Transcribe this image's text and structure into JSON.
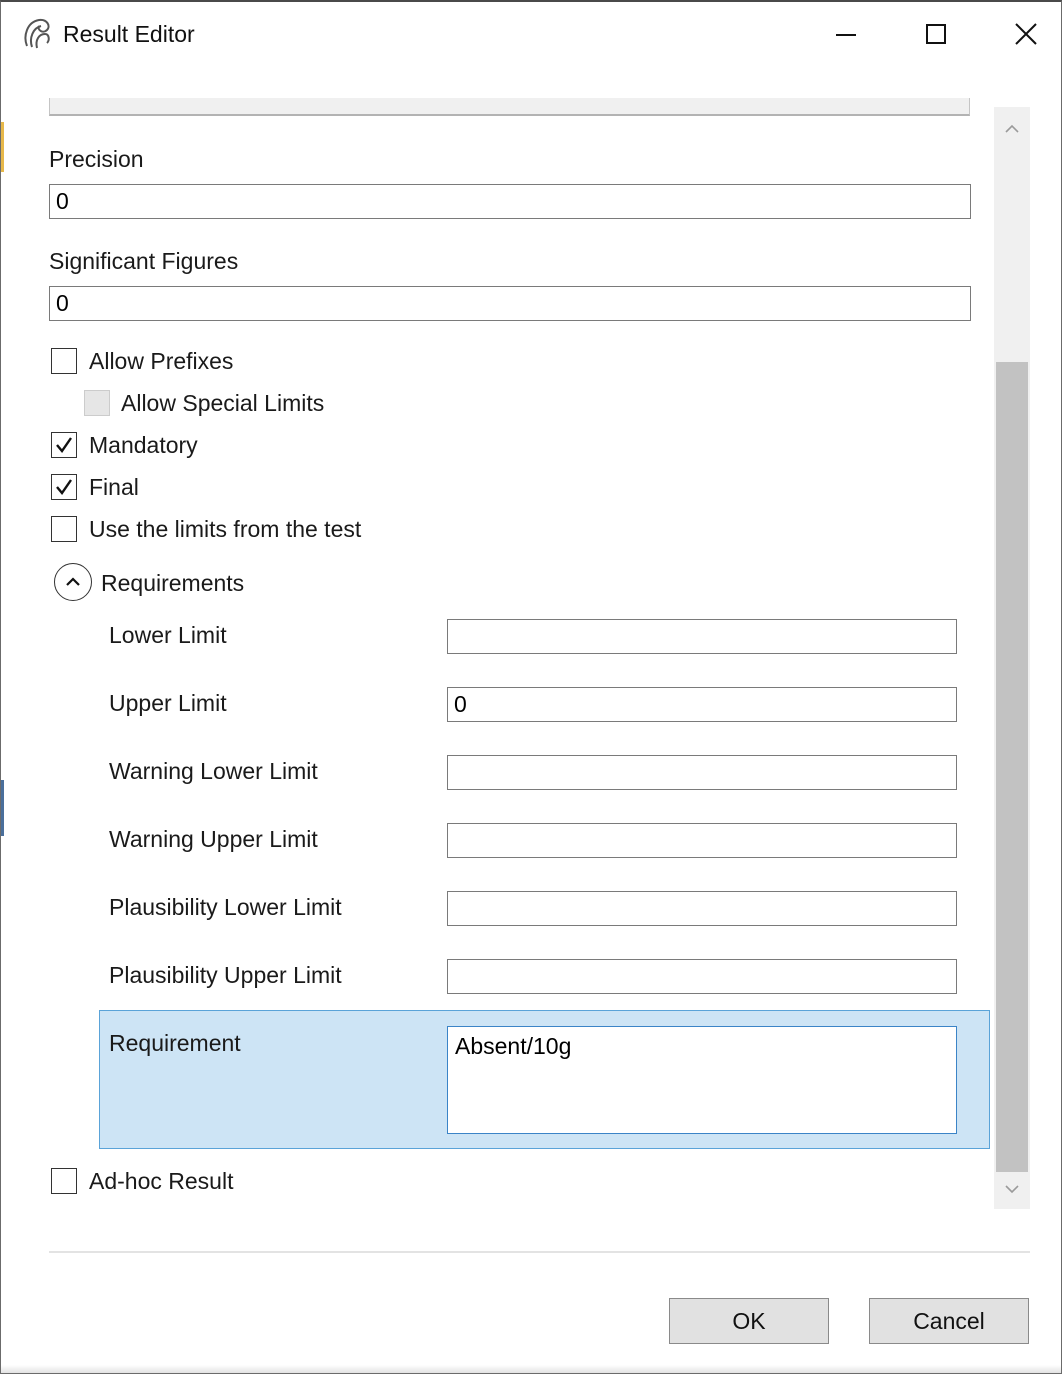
{
  "window": {
    "title": "Result Editor",
    "controls": {
      "minimize_icon": "minimize-icon",
      "maximize_icon": "maximize-icon",
      "close_icon": "close-icon"
    }
  },
  "form": {
    "precision": {
      "label": "Precision",
      "value": "0"
    },
    "significant_figures": {
      "label": "Significant Figures",
      "value": "0"
    },
    "checkboxes": {
      "allow_prefixes": {
        "label": "Allow Prefixes",
        "checked": false
      },
      "allow_special_limits": {
        "label": "Allow Special Limits",
        "checked": false,
        "enabled": false
      },
      "mandatory": {
        "label": "Mandatory",
        "checked": true
      },
      "final": {
        "label": "Final",
        "checked": true
      },
      "use_test_limits": {
        "label": "Use the limits from the test",
        "checked": false
      },
      "ad_hoc_result": {
        "label": "Ad-hoc Result",
        "checked": false
      }
    },
    "requirements": {
      "header": "Requirements",
      "expanded": true,
      "lower_limit": {
        "label": "Lower Limit",
        "value": ""
      },
      "upper_limit": {
        "label": "Upper Limit",
        "value": "0"
      },
      "warning_lower_limit": {
        "label": "Warning Lower Limit",
        "value": ""
      },
      "warning_upper_limit": {
        "label": "Warning Upper Limit",
        "value": ""
      },
      "plausibility_lower_limit": {
        "label": "Plausibility Lower Limit",
        "value": ""
      },
      "plausibility_upper_limit": {
        "label": "Plausibility Upper Limit",
        "value": ""
      },
      "requirement": {
        "label": "Requirement",
        "value": "Absent/10g"
      }
    }
  },
  "buttons": {
    "ok": "OK",
    "cancel": "Cancel"
  },
  "colors": {
    "selection_fill": "#cde4f5",
    "selection_border": "#5aa3d8",
    "scroll_thumb": "#c2c2c2"
  }
}
